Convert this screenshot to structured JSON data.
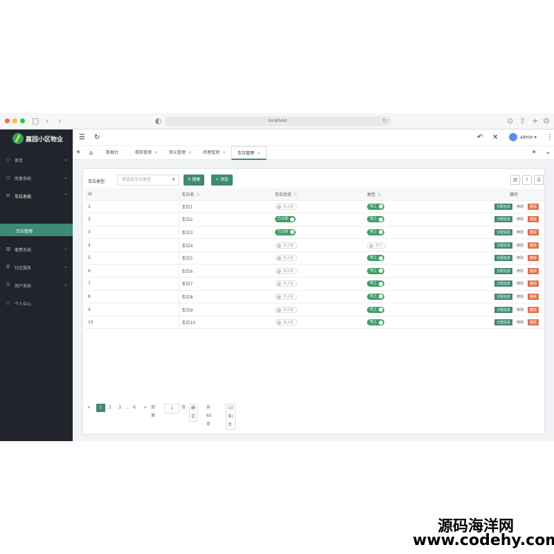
{
  "browser": {
    "url": "localhost"
  },
  "sidebar": {
    "brand": "嘉园小区物业",
    "items": [
      {
        "icon": "○",
        "label": "首页"
      },
      {
        "icon": "□",
        "label": "房屋系统"
      },
      {
        "icon": "⊟",
        "label": "车位系统"
      },
      {
        "icon": "▥",
        "label": "缴费系统"
      },
      {
        "icon": "☰",
        "label": "社区服务"
      },
      {
        "icon": "☷",
        "label": "用户系统"
      },
      {
        "icon": "○",
        "label": "个人中心"
      }
    ],
    "active_sub": "车位管理"
  },
  "header": {
    "user": "admin"
  },
  "tabs": [
    {
      "label": "数据台"
    },
    {
      "label": "楼栋管理"
    },
    {
      "label": "单元管理"
    },
    {
      "label": "房屋管理"
    },
    {
      "label": "车位管理"
    }
  ],
  "filter": {
    "label": "车位类型:",
    "placeholder": "请选择车位类型",
    "search_btn": "搜索",
    "add_btn": "添加"
  },
  "table": {
    "headers": {
      "id": "Id",
      "name": "车位名",
      "status": "车位状态",
      "type": "类型",
      "ops": "操作"
    },
    "ops": {
      "assign": "分配信息",
      "edit": "修改",
      "delete": "删除"
    },
    "rows": [
      {
        "id": "1",
        "name": "车位1",
        "status": "未占有",
        "status_on": false,
        "type": "地上",
        "type_on": true
      },
      {
        "id": "2",
        "name": "车位2",
        "status": "已占有",
        "status_on": true,
        "type": "地上",
        "type_on": true
      },
      {
        "id": "3",
        "name": "车位3",
        "status": "已占有",
        "status_on": true,
        "type": "地上",
        "type_on": true
      },
      {
        "id": "4",
        "name": "车位4",
        "status": "未占有",
        "status_on": false,
        "type": "地下",
        "type_on": false
      },
      {
        "id": "5",
        "name": "车位5",
        "status": "未占有",
        "status_on": false,
        "type": "地上",
        "type_on": true
      },
      {
        "id": "6",
        "name": "车位6",
        "status": "未占有",
        "status_on": false,
        "type": "地上",
        "type_on": true
      },
      {
        "id": "7",
        "name": "车位7",
        "status": "未占有",
        "status_on": false,
        "type": "地上",
        "type_on": true
      },
      {
        "id": "8",
        "name": "车位8",
        "status": "未占有",
        "status_on": false,
        "type": "地上",
        "type_on": true
      },
      {
        "id": "9",
        "name": "车位9",
        "status": "未占有",
        "status_on": false,
        "type": "地上",
        "type_on": true
      },
      {
        "id": "10",
        "name": "车位10",
        "status": "未占有",
        "status_on": false,
        "type": "地上",
        "type_on": true
      }
    ]
  },
  "pager": {
    "prev": "<",
    "pages": [
      "1",
      "2",
      "3",
      "...",
      "6"
    ],
    "next": ">",
    "goto_label": "到第",
    "goto_value": "1",
    "page_unit": "页",
    "confirm": "确定",
    "total": "共 60 条",
    "page_size": "10 条/页"
  },
  "watermark": {
    "line1": "源码海洋网",
    "line2": "www.codehy.com"
  }
}
